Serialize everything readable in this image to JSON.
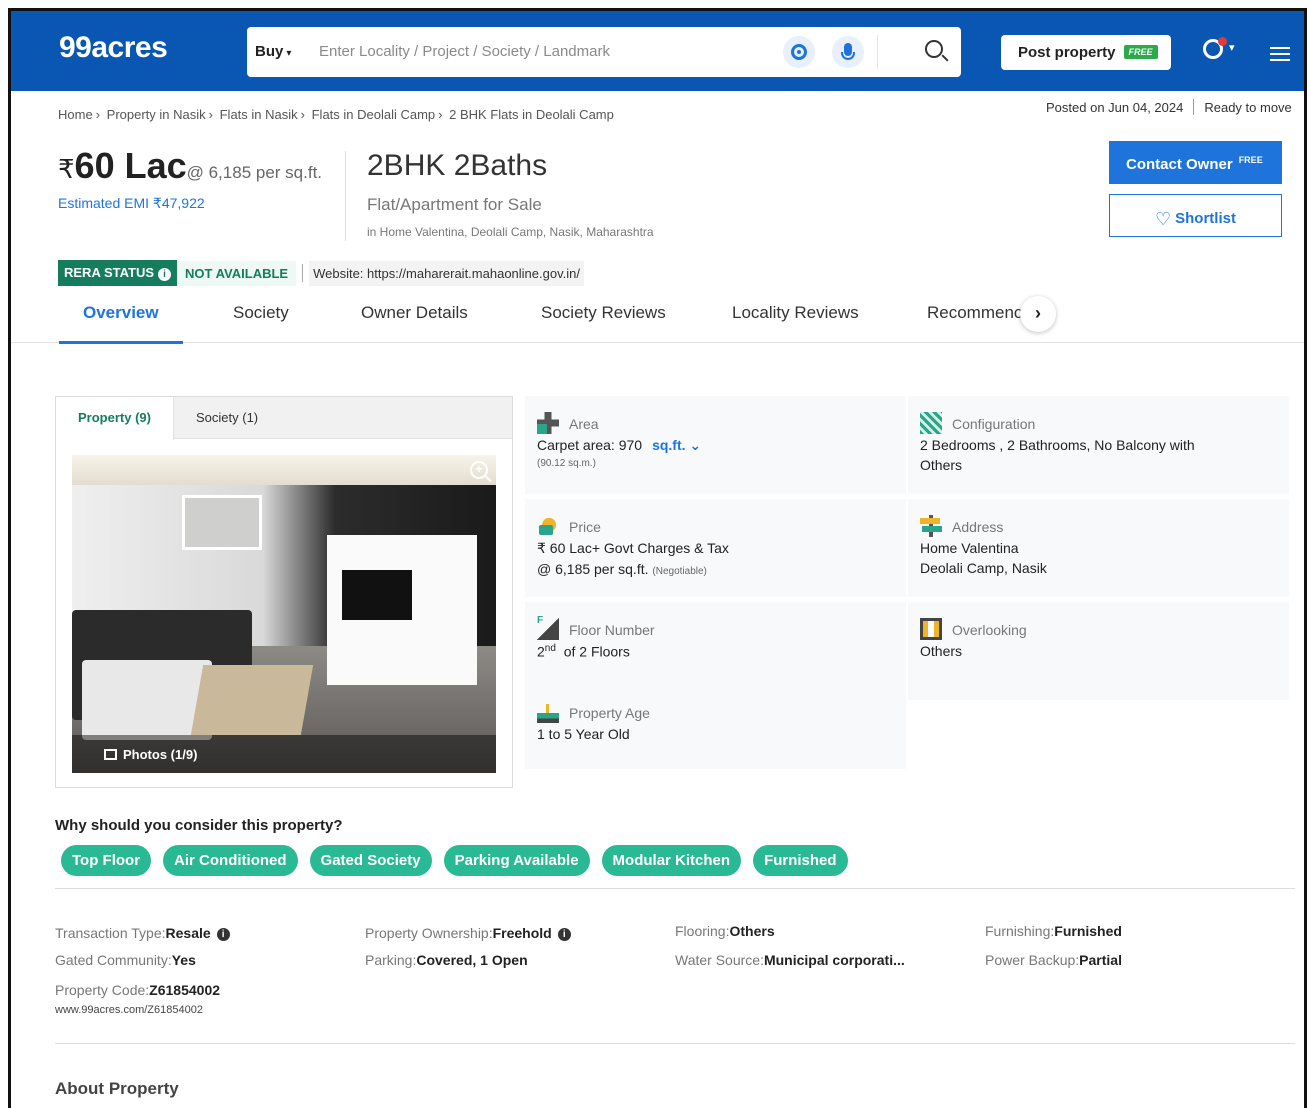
{
  "header": {
    "logo": "99acres",
    "search_mode": "Buy",
    "search_placeholder": "Enter Locality / Project / Society / Landmark",
    "post_property": "Post property",
    "post_free_tag": "FREE"
  },
  "breadcrumb": [
    "Home",
    "Property in Nasik",
    "Flats in Nasik",
    "Flats in Deolali Camp",
    "2 BHK Flats in Deolali Camp"
  ],
  "posted": "Posted on Jun 04, 2024",
  "possession": "Ready to move",
  "listing": {
    "currency": "₹",
    "price": "60 Lac",
    "price_per_sqft": "@ 6,185 per sq.ft.",
    "emi": "Estimated EMI ₹47,922",
    "title": "2BHK 2Baths",
    "subtitle": "Flat/Apartment for Sale",
    "location": "in Home Valentina, Deolali Camp, Nasik, Maharashtra"
  },
  "actions": {
    "contact": "Contact Owner",
    "contact_tag": "FREE",
    "shortlist": "Shortlist"
  },
  "rera": {
    "label": "RERA STATUS",
    "status": "NOT AVAILABLE",
    "website": "Website: https://maharerait.mahaonline.gov.in/"
  },
  "tabs": [
    "Overview",
    "Society",
    "Owner Details",
    "Society Reviews",
    "Locality Reviews",
    "Recommenc"
  ],
  "photo_tabs": [
    "Property (9)",
    "Society (1)"
  ],
  "photo_count": "Photos (1/9)",
  "details": {
    "area": {
      "label": "Area",
      "value": "Carpet area: 970",
      "unit": "sq.ft.",
      "sub": "(90.12 sq.m.)"
    },
    "configuration": {
      "label": "Configuration",
      "line1": "2 Bedrooms , 2 Bathrooms, No Balcony with",
      "line2": "Others"
    },
    "price": {
      "label": "Price",
      "line1": "₹ 60 Lac+ Govt Charges & Tax",
      "line2": "@ 6,185 per sq.ft.",
      "note": "(Negotiable)"
    },
    "address": {
      "label": "Address",
      "line1": "Home Valentina",
      "line2": "Deolali Camp, Nasik"
    },
    "floor": {
      "label": "Floor Number",
      "floor_num": "2",
      "floor_suffix": "nd",
      "of": "of 2 Floors"
    },
    "overlooking": {
      "label": "Overlooking",
      "value": "Others"
    },
    "age": {
      "label": "Property Age",
      "value": "1 to 5 Year Old"
    }
  },
  "why_title": "Why should you consider this property?",
  "chips": [
    "Top Floor",
    "Air Conditioned",
    "Gated Society",
    "Parking Available",
    "Modular Kitchen",
    "Furnished"
  ],
  "facts": {
    "transaction": {
      "k": "Transaction Type",
      "v": "Resale"
    },
    "ownership": {
      "k": "Property Ownership",
      "v": "Freehold"
    },
    "flooring": {
      "k": "Flooring",
      "v": "Others"
    },
    "furnishing": {
      "k": "Furnishing",
      "v": "Furnished"
    },
    "gated": {
      "k": "Gated Community",
      "v": "Yes"
    },
    "parking": {
      "k": "Parking",
      "v": "Covered, 1 Open"
    },
    "water": {
      "k": "Water Source",
      "v": "Municipal corporati..."
    },
    "backup": {
      "k": "Power Backup",
      "v": "Partial"
    },
    "code": {
      "k": "Property Code",
      "v": "Z61854002"
    }
  },
  "property_url": "www.99acres.com/Z61854002",
  "about_title": "About Property",
  "colors": {
    "brand_blue": "#0a56b3",
    "accent_blue": "#1f74dc",
    "green": "#157c5c",
    "chip_green": "#2ab995"
  }
}
